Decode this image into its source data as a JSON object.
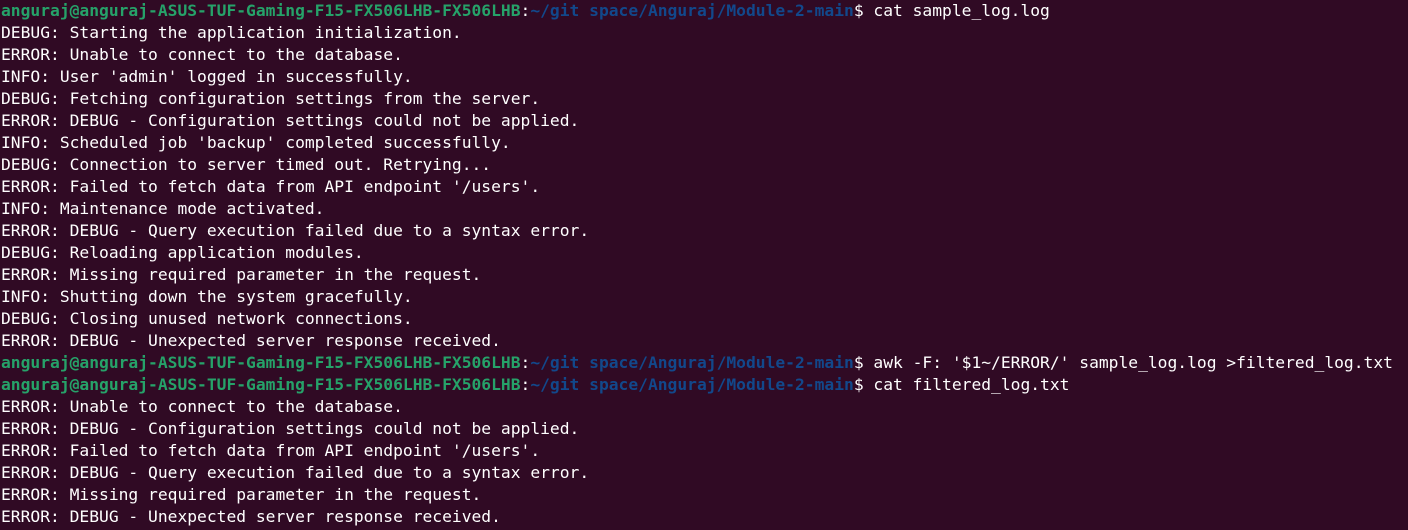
{
  "colors": {
    "background": "#300a24",
    "user_host": "#26a269",
    "path": "#12488b",
    "text": "#ffffff"
  },
  "terminal": {
    "prompt": {
      "user_host": "anguraj@anguraj-ASUS-TUF-Gaming-F15-FX506LHB-FX506LHB",
      "separator": ":",
      "path": "~/git space/Anguraj/Module-2-main",
      "symbol": "$ "
    },
    "lines": [
      {
        "type": "prompt",
        "command": "cat sample_log.log"
      },
      {
        "type": "output",
        "text": "DEBUG: Starting the application initialization."
      },
      {
        "type": "output",
        "text": "ERROR: Unable to connect to the database."
      },
      {
        "type": "output",
        "text": "INFO: User 'admin' logged in successfully."
      },
      {
        "type": "output",
        "text": "DEBUG: Fetching configuration settings from the server."
      },
      {
        "type": "output",
        "text": "ERROR: DEBUG - Configuration settings could not be applied."
      },
      {
        "type": "output",
        "text": "INFO: Scheduled job 'backup' completed successfully."
      },
      {
        "type": "output",
        "text": "DEBUG: Connection to server timed out. Retrying..."
      },
      {
        "type": "output",
        "text": "ERROR: Failed to fetch data from API endpoint '/users'."
      },
      {
        "type": "output",
        "text": "INFO: Maintenance mode activated."
      },
      {
        "type": "output",
        "text": "ERROR: DEBUG - Query execution failed due to a syntax error."
      },
      {
        "type": "output",
        "text": "DEBUG: Reloading application modules."
      },
      {
        "type": "output",
        "text": "ERROR: Missing required parameter in the request."
      },
      {
        "type": "output",
        "text": "INFO: Shutting down the system gracefully."
      },
      {
        "type": "output",
        "text": "DEBUG: Closing unused network connections."
      },
      {
        "type": "output",
        "text": "ERROR: DEBUG - Unexpected server response received."
      },
      {
        "type": "prompt",
        "command": "awk -F: '$1~/ERROR/' sample_log.log >filtered_log.txt"
      },
      {
        "type": "prompt",
        "command": "cat filtered_log.txt"
      },
      {
        "type": "output",
        "text": "ERROR: Unable to connect to the database."
      },
      {
        "type": "output",
        "text": "ERROR: DEBUG - Configuration settings could not be applied."
      },
      {
        "type": "output",
        "text": "ERROR: Failed to fetch data from API endpoint '/users'."
      },
      {
        "type": "output",
        "text": "ERROR: DEBUG - Query execution failed due to a syntax error."
      },
      {
        "type": "output",
        "text": "ERROR: Missing required parameter in the request."
      },
      {
        "type": "output",
        "text": "ERROR: DEBUG - Unexpected server response received."
      }
    ]
  }
}
